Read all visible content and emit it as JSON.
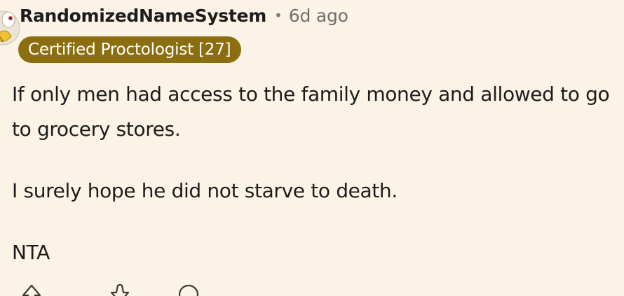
{
  "comment": {
    "author": "RandomizedNameSystem",
    "separator": "•",
    "time_ago": "6d ago",
    "flair": "Certified Proctologist [27]",
    "paragraphs": [
      "If only men had access to the family money and allowed to go to grocery stores.",
      "I surely hope he did not starve to death.",
      "NTA"
    ]
  },
  "icons": {
    "avatar": "snoo-avatar-icon",
    "upvote": "upvote-icon",
    "downvote": "downvote-icon",
    "reply": "reply-bubble-icon"
  },
  "colors": {
    "background": "#fbf4e6",
    "flair_background": "#8b6e10",
    "flair_text": "#ffffff",
    "text": "#1c1c1c",
    "muted": "#6f6f6f"
  }
}
